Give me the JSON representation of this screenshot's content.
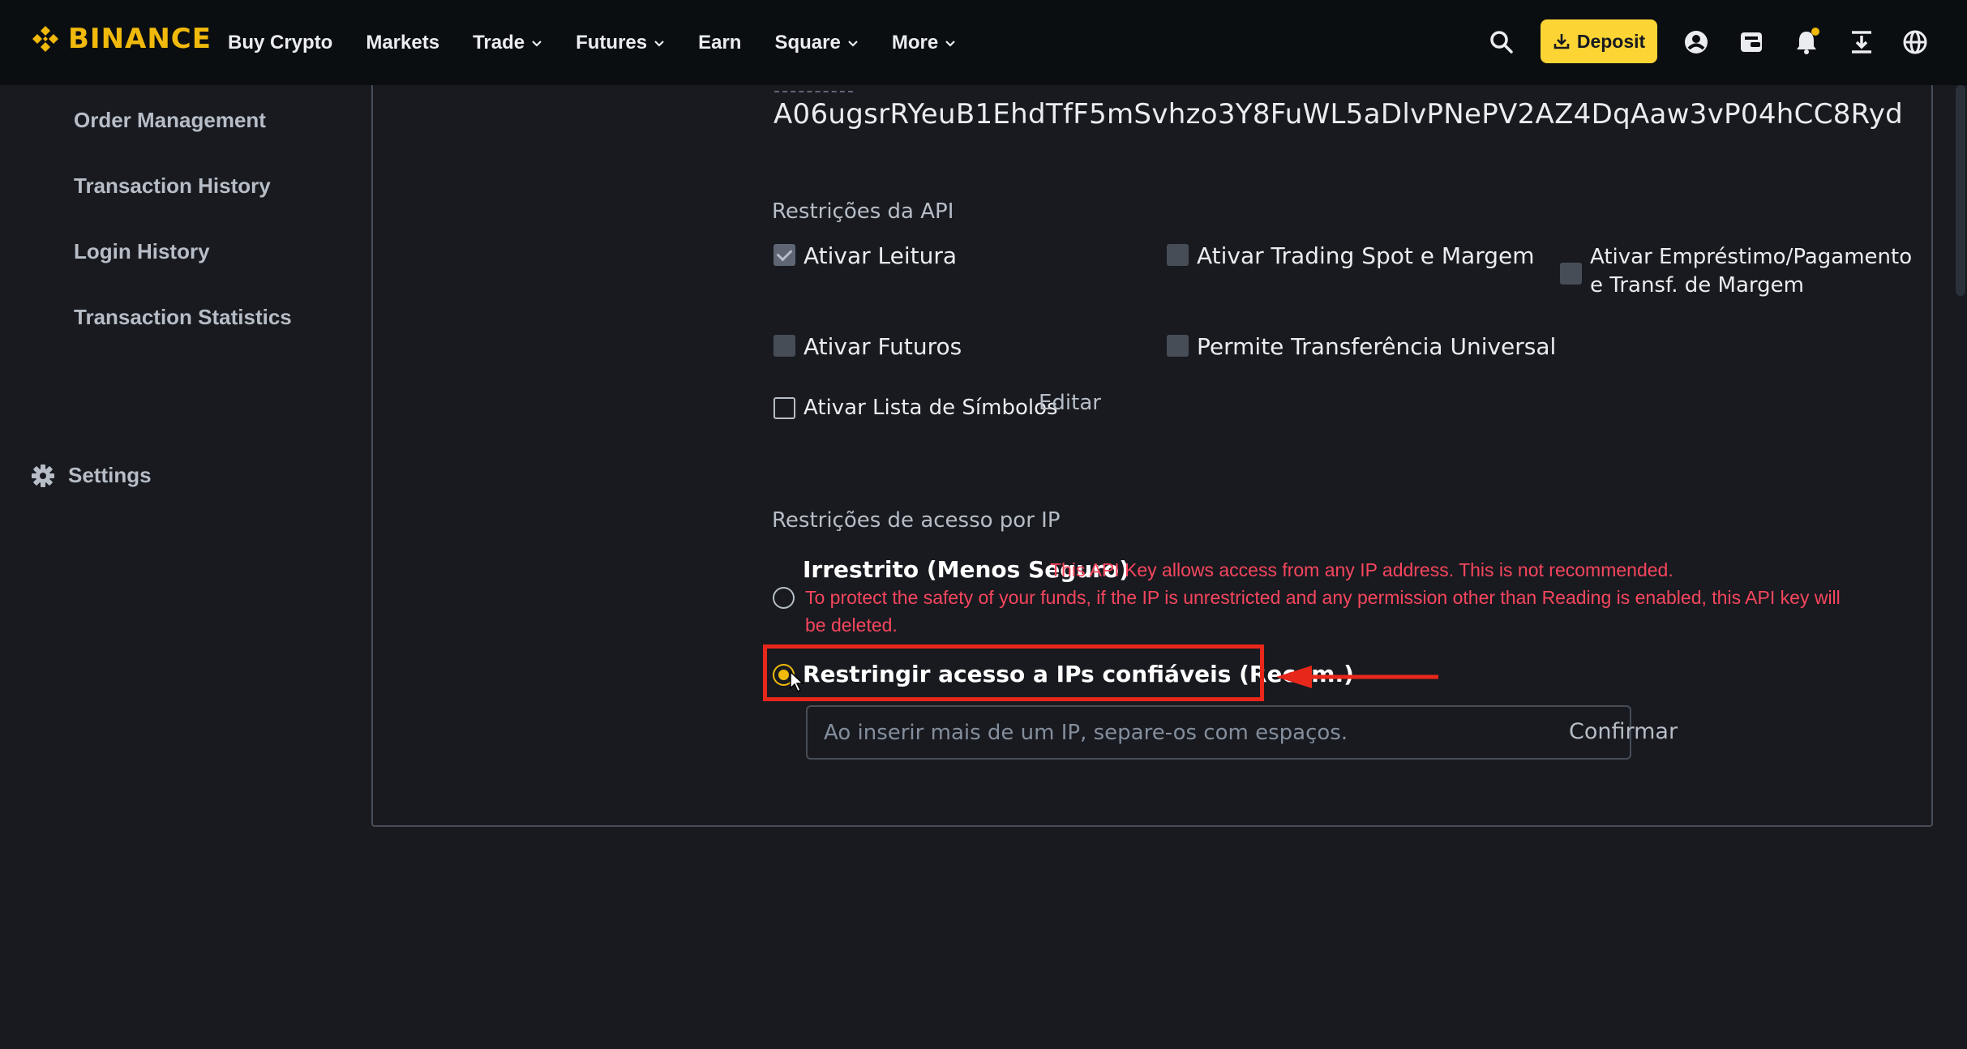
{
  "nav": {
    "logo_text": "BINANCE",
    "items": [
      {
        "label": "Buy Crypto",
        "dropdown": false
      },
      {
        "label": "Markets",
        "dropdown": false
      },
      {
        "label": "Trade",
        "dropdown": true
      },
      {
        "label": "Futures",
        "dropdown": true
      },
      {
        "label": "Earn",
        "dropdown": false
      },
      {
        "label": "Square",
        "dropdown": true
      },
      {
        "label": "More",
        "dropdown": true
      }
    ],
    "deposit_label": "Deposit",
    "icons": [
      "search-icon",
      "user-icon",
      "wallet-icon",
      "bell-icon",
      "download-app-icon",
      "globe-icon"
    ]
  },
  "sidebar": {
    "links": [
      "Order Management",
      "Transaction History",
      "Login History",
      "Transaction Statistics"
    ],
    "settings_label": "Settings"
  },
  "api": {
    "secret_key": "A06ugsrRYeuB1EhdTfF5mSvhzo3Y8FuWL5aDlvPNePV2AZ4DqAaw3vP04hCC8Ryd",
    "restrictions_title": "Restrições da API",
    "permissions": {
      "read": {
        "label": "Ativar Leitura",
        "checked": true
      },
      "spot_margin": {
        "label": "Ativar Trading Spot e Margem",
        "checked": false
      },
      "loan_line1": "Ativar Empréstimo/Pagamento",
      "loan_line2": "e Transf. de Margem",
      "futures": {
        "label": "Ativar Futuros",
        "checked": false
      },
      "universal_transfer": {
        "label": "Permite Transferência Universal",
        "checked": false
      },
      "symbol_whitelist": {
        "label": "Ativar Lista de Símbolos",
        "checked": false
      }
    },
    "edit_label": "Editar",
    "ip_title": "Restrições de acesso por IP",
    "ip_options": {
      "unrestricted": "Irrestrito (Menos Seguro)",
      "restricted": "Restringir acesso a IPs confiáveis (Recom.)"
    },
    "warning_line1": "This API Key allows access from any IP address. This is not recommended.",
    "warning_line2": "To protect the safety of your funds, if the IP is unrestricted and any permission other than Reading is enabled, this API key will",
    "warning_line3": "be deleted.",
    "ip_input_placeholder": "Ao inserir mais de um IP, separe-os com espaços.",
    "confirm_label": "Confirmar"
  },
  "colors": {
    "brand": "#f0b90b",
    "deposit_bg": "#fcd535",
    "warning": "#f6465d",
    "annotation": "#e8271b"
  }
}
